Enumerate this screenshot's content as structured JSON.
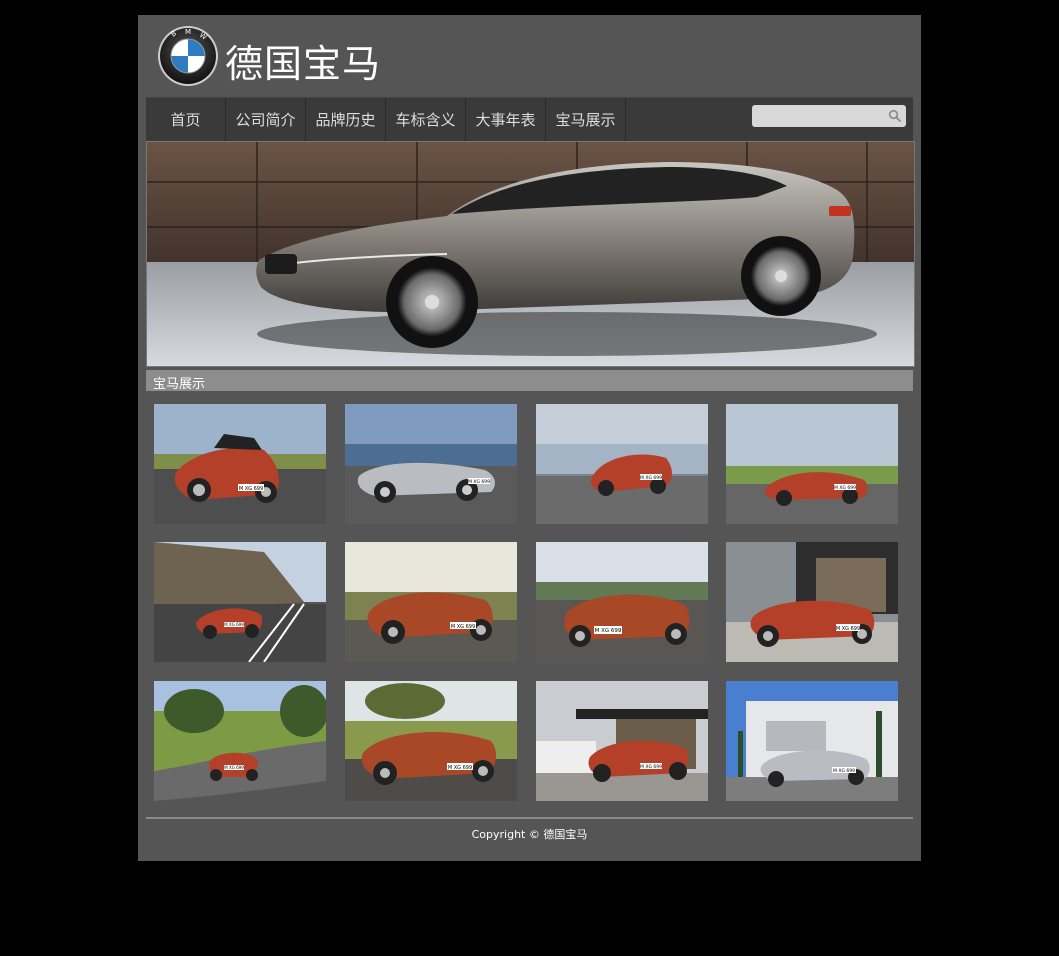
{
  "header": {
    "brand": "德国宝马",
    "logo_letters": "BMW"
  },
  "nav": {
    "items": [
      "首页",
      "公司简介",
      "品牌历史",
      "车标含义",
      "大事年表",
      "宝马展示"
    ]
  },
  "search": {
    "value": "",
    "placeholder": ""
  },
  "section": {
    "title": "宝马展示"
  },
  "gallery": {
    "plates": [
      "M XG 699",
      "M XG 699",
      "M XG 699",
      "M XG 699",
      "M XG 699",
      "M XG 699",
      "M XG 699",
      "M XG 699",
      "M XG 699",
      "M XG 699",
      "M XG 699",
      "M XG 699"
    ]
  },
  "footer": {
    "copyright": "Copyright © 德国宝马"
  },
  "colors": {
    "background": "#000000",
    "page": "#555555",
    "nav": "#3a3a3a",
    "section_bar": "#8d8d8d",
    "car_red": "#b5402a",
    "car_silver": "#b9bcc0"
  }
}
